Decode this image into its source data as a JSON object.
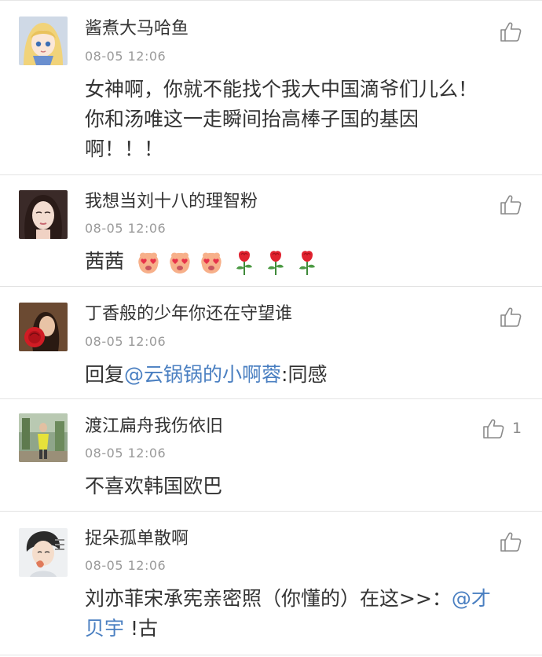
{
  "comments": [
    {
      "username": "酱煮大马哈鱼",
      "time": "08-05 12:06",
      "text_line1": "女神啊，你就不能找个我大中国滴爷们儿么！",
      "text_line2": "你和汤唯这一走瞬间抬高棒子国的基因",
      "text_line3": "啊！！！",
      "like_icon": "thumbs-up-icon"
    },
    {
      "username": "我想当刘十八的理智粉",
      "time": "08-05 12:06",
      "text": "茜茜",
      "emojis": [
        "heart-eyes-face-emoji",
        "heart-eyes-face-emoji",
        "heart-eyes-face-emoji",
        "rose-emoji",
        "rose-emoji",
        "rose-emoji"
      ],
      "like_icon": "thumbs-up-icon"
    },
    {
      "username": "丁香般的少年你还在守望谁",
      "time": "08-05 12:06",
      "text_prefix": "回复",
      "mention": "@云锅锅的小啊蓉",
      "text_suffix": ":同感",
      "like_icon": "thumbs-up-icon"
    },
    {
      "username": "渡江扁舟我伤依旧",
      "time": "08-05 12:06",
      "text": "不喜欢韩国欧巴",
      "like_count": "1",
      "like_icon": "thumbs-up-icon"
    },
    {
      "username": "捉朵孤单散啊",
      "time": "08-05 12:06",
      "text_line1_main": "刘亦菲宋承宪亲密照（你懂的）在这>>：",
      "text_line1_mention": "@才",
      "text_line2_mention": "贝宇",
      "text_line2_rest": "!古",
      "like_icon": "thumbs-up-icon"
    }
  ],
  "colors": {
    "text": "#333333",
    "time": "#9a9a9a",
    "mention": "#4a7fc1",
    "divider": "#e3e3e3"
  }
}
